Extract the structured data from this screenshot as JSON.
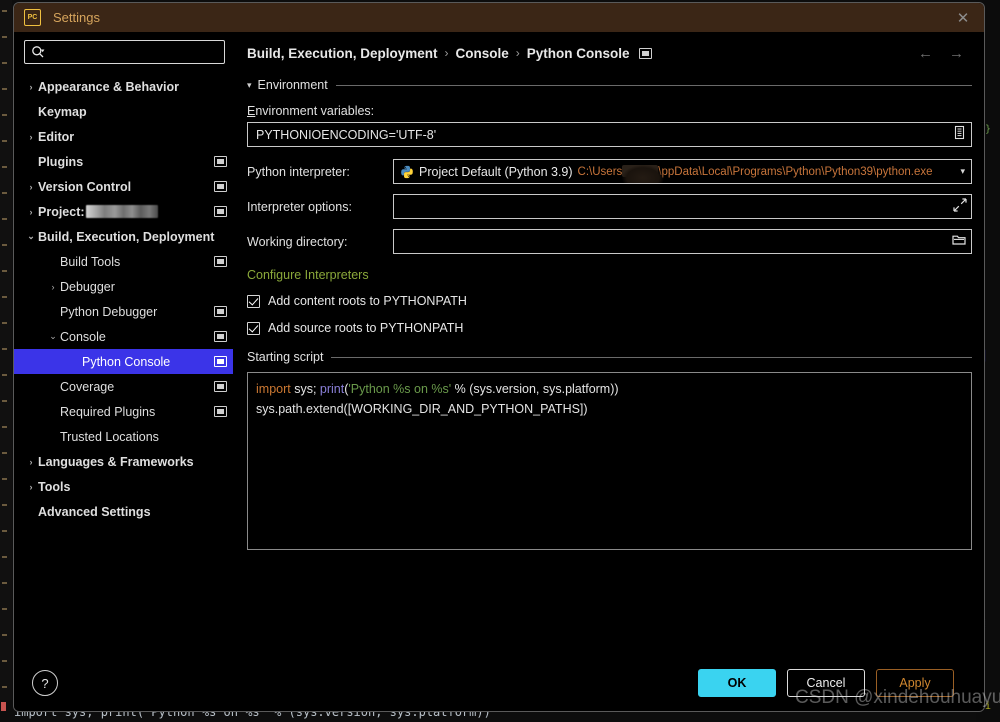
{
  "window": {
    "title": "Settings",
    "app_icon": "pycharm-icon",
    "close_label": "✕"
  },
  "sidebar": {
    "search": {
      "placeholder": "",
      "value": "",
      "icon": "search-icon"
    },
    "items": [
      {
        "label": "Appearance & Behavior",
        "arrow": "›",
        "bold": true,
        "indent": 0,
        "store_icon": false,
        "selected": false
      },
      {
        "label": "Keymap",
        "arrow": "",
        "bold": true,
        "indent": 0,
        "store_icon": false,
        "selected": false
      },
      {
        "label": "Editor",
        "arrow": "›",
        "bold": true,
        "indent": 0,
        "store_icon": false,
        "selected": false
      },
      {
        "label": "Plugins",
        "arrow": "",
        "bold": true,
        "indent": 0,
        "store_icon": true,
        "selected": false
      },
      {
        "label": "Version Control",
        "arrow": "›",
        "bold": true,
        "indent": 0,
        "store_icon": true,
        "selected": false
      },
      {
        "label": "Project:",
        "arrow": "›",
        "bold": true,
        "indent": 0,
        "store_icon": true,
        "selected": false,
        "redacted": true
      },
      {
        "label": "Build, Execution, Deployment",
        "arrow": "⌄",
        "bold": true,
        "indent": 0,
        "store_icon": false,
        "selected": false
      },
      {
        "label": "Build Tools",
        "arrow": "",
        "bold": false,
        "indent": 1,
        "store_icon": true,
        "selected": false
      },
      {
        "label": "Debugger",
        "arrow": "›",
        "bold": false,
        "indent": 1,
        "store_icon": false,
        "selected": false
      },
      {
        "label": "Python Debugger",
        "arrow": "",
        "bold": false,
        "indent": 1,
        "store_icon": true,
        "selected": false
      },
      {
        "label": "Console",
        "arrow": "⌄",
        "bold": false,
        "indent": 1,
        "store_icon": true,
        "selected": false
      },
      {
        "label": "Python Console",
        "arrow": "",
        "bold": false,
        "indent": 2,
        "store_icon": true,
        "selected": true
      },
      {
        "label": "Coverage",
        "arrow": "",
        "bold": false,
        "indent": 1,
        "store_icon": true,
        "selected": false
      },
      {
        "label": "Required Plugins",
        "arrow": "",
        "bold": false,
        "indent": 1,
        "store_icon": true,
        "selected": false
      },
      {
        "label": "Trusted Locations",
        "arrow": "",
        "bold": false,
        "indent": 1,
        "store_icon": false,
        "selected": false
      },
      {
        "label": "Languages & Frameworks",
        "arrow": "›",
        "bold": true,
        "indent": 0,
        "store_icon": false,
        "selected": false
      },
      {
        "label": "Tools",
        "arrow": "›",
        "bold": true,
        "indent": 0,
        "store_icon": false,
        "selected": false
      },
      {
        "label": "Advanced Settings",
        "arrow": "",
        "bold": true,
        "indent": 0,
        "store_icon": false,
        "selected": false
      }
    ]
  },
  "main": {
    "breadcrumb": {
      "parts": [
        "Build, Execution, Deployment",
        "Console",
        "Python Console"
      ],
      "separator": "›"
    },
    "nav": {
      "back": "←",
      "forward": "→"
    },
    "section": {
      "title": "Environment",
      "triangle": "▾"
    },
    "env_vars": {
      "label": "Environment variables:",
      "mnemonic": "E",
      "rest": "nvironment variables:",
      "value": "PYTHONIOENCODING='UTF-8'",
      "browse_icon": "list-edit-icon"
    },
    "interpreter": {
      "label": "Python interpreter:",
      "mnemonic": "P",
      "rest": "ython interpreter:",
      "name": "Project Default (Python 3.9)",
      "path_before": "C:\\Users",
      "path_after": "\\ppData\\Local\\Programs\\Python\\Python39\\python.exe",
      "icon": "python-icon",
      "arrow": "▾"
    },
    "interpreter_options": {
      "label": "Interpreter options:",
      "mnemonic": "I",
      "rest": "nterpreter options:",
      "value": "",
      "expand_icon": "expand-icon"
    },
    "working_directory": {
      "label": "Working directory:",
      "mnemonic": "W",
      "rest": "orking directory:",
      "value": "",
      "browse_icon": "folder-icon"
    },
    "configure_link": "Configure Interpreters",
    "checkboxes": [
      {
        "label": "Add content roots to PYTHONPATH",
        "checked": true
      },
      {
        "label": "Add source roots to PYTHONPATH",
        "checked": true
      }
    ],
    "starting_script": {
      "title": "Starting script",
      "line1": {
        "kw": "import",
        "mid": " sys; ",
        "fn": "print",
        "open": "(",
        "str": "'Python %s on %s'",
        "tail": " % (sys.version, sys.platform))"
      },
      "line2": "sys.path.extend([WORKING_DIR_AND_PYTHON_PATHS])"
    }
  },
  "footer": {
    "help": "?",
    "ok": "OK",
    "cancel": "Cancel",
    "apply": "Apply"
  },
  "overlay": {
    "watermark": "CSDN @xindehouhuayuan"
  },
  "background": {
    "code_line": "import sys; print('Python %s on %s' % (sys.version, sys.platform))"
  },
  "colors": {
    "titlebar": "#3b2616",
    "title_text": "#d6a45c",
    "selection": "#3b34e8",
    "link": "#8aa83a",
    "path": "#c8753b",
    "ok": "#3ad3f0",
    "apply": "#d0872f"
  }
}
